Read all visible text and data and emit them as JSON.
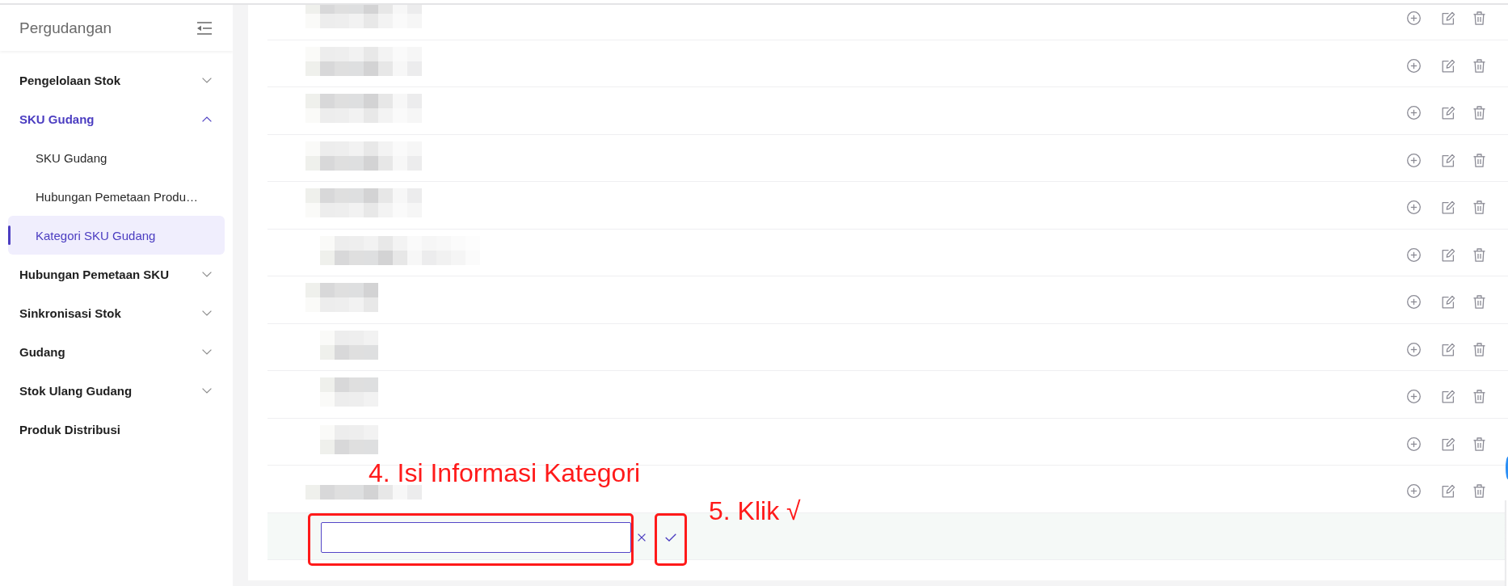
{
  "sidebar": {
    "title": "Pergudangan",
    "items": [
      {
        "kind": "group",
        "label": "Pengelolaan Stok",
        "expanded": false
      },
      {
        "kind": "group",
        "label": "SKU Gudang",
        "expanded": true,
        "children": [
          {
            "label": "SKU Gudang",
            "selected": false
          },
          {
            "label": "Hubungan Pemetaan Produ…",
            "selected": false
          },
          {
            "label": "Kategori SKU Gudang",
            "selected": true
          }
        ]
      },
      {
        "kind": "group",
        "label": "Hubungan Pemetaan SKU",
        "expanded": false
      },
      {
        "kind": "group",
        "label": "Sinkronisasi Stok",
        "expanded": false
      },
      {
        "kind": "group",
        "label": "Gudang",
        "expanded": false
      },
      {
        "kind": "group",
        "label": "Stok Ulang Gudang",
        "expanded": false
      },
      {
        "kind": "link",
        "label": "Produk Distribusi",
        "selected": false
      }
    ]
  },
  "table": {
    "rows": [
      {
        "kind": "long"
      },
      {
        "kind": "long"
      },
      {
        "kind": "long"
      },
      {
        "kind": "long"
      },
      {
        "kind": "long"
      },
      {
        "kind": "wide"
      },
      {
        "kind": "short"
      },
      {
        "kind": "narrow"
      },
      {
        "kind": "narrow"
      },
      {
        "kind": "narrow"
      },
      {
        "kind": "single"
      }
    ]
  },
  "new_row": {
    "input": {
      "highlighted": true,
      "callout": "4. Isi Informasi Kategori"
    },
    "confirm": {
      "highlighted": true,
      "callout": "5. Klik √"
    }
  }
}
